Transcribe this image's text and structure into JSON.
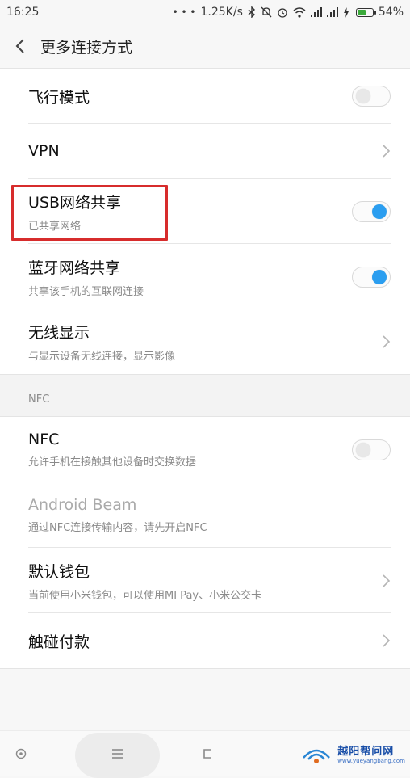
{
  "status_bar": {
    "time": "16:25",
    "dots": "• • •",
    "speed": "1.25K/s",
    "battery": "54%",
    "battery_level": 0.54
  },
  "header": {
    "title": "更多连接方式"
  },
  "rows": {
    "airplane": {
      "title": "飞行模式",
      "toggle_on": false
    },
    "vpn": {
      "title": "VPN"
    },
    "usb": {
      "title": "USB网络共享",
      "subtitle": "已共享网络",
      "toggle_on": true
    },
    "bluetooth": {
      "title": "蓝牙网络共享",
      "subtitle": "共享该手机的互联网连接",
      "toggle_on": true
    },
    "wireless_display": {
      "title": "无线显示",
      "subtitle": "与显示设备无线连接，显示影像"
    },
    "nfc": {
      "title": "NFC",
      "subtitle": "允许手机在接触其他设备时交换数据",
      "toggle_on": false
    },
    "android_beam": {
      "title": "Android Beam",
      "subtitle": "通过NFC连接传输内容，请先开启NFC"
    },
    "wallet": {
      "title": "默认钱包",
      "subtitle": "当前使用小米钱包，可以使用MI Pay、小米公交卡"
    },
    "tap_pay": {
      "title": "触碰付款"
    }
  },
  "section": {
    "nfc_label": "NFC"
  },
  "watermark": {
    "main": "越阳帮问网",
    "sub": "www.yueyangbang.com"
  },
  "colors": {
    "accent": "#2b9ef0",
    "highlight": "#d72c2c"
  }
}
